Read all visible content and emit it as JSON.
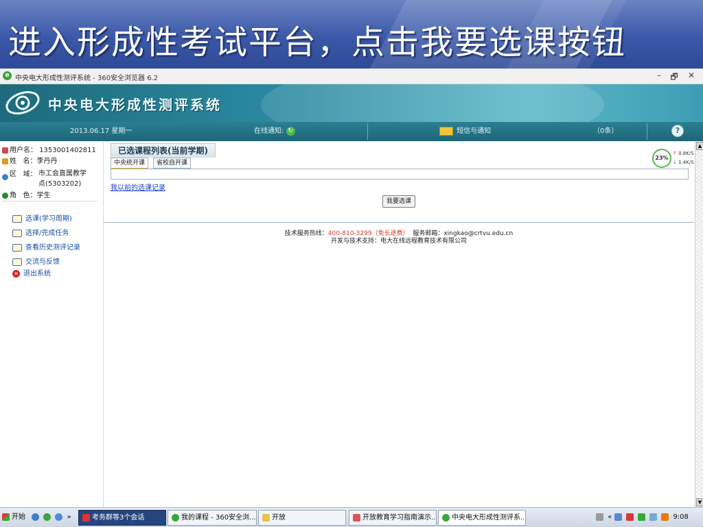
{
  "slide": {
    "title": "进入形成性考试平台，点击我要选课按钮"
  },
  "browser": {
    "title": "中央电大形成性测评系统 - 360安全浏览器 6.2",
    "minimize": "–",
    "restore": "🗗",
    "close": "✕"
  },
  "app": {
    "name": "中央电大形成性测评系统",
    "status": {
      "date": "2013.06.17 星期一",
      "online_notice": "在线通知:",
      "messages": "短信与通知",
      "count": "（0条）",
      "help": "?"
    }
  },
  "user": {
    "username_label": "用户名：",
    "username": "1353001402811",
    "name_label": "姓   名：",
    "name": "李丹丹",
    "region_label": "区   域：",
    "region_line1": "市工会直属教学",
    "region_line2": "点(5303202)",
    "role_label": "角   色：",
    "role": "学生"
  },
  "menu": [
    {
      "label": "选课(学习周期)"
    },
    {
      "label": "选择/完成任务"
    },
    {
      "label": "查看历史测评记录"
    },
    {
      "label": "交流与反馈"
    },
    {
      "label": "退出系统"
    }
  ],
  "main": {
    "section_title": "已选课程列表(当前学期)",
    "tabs": [
      {
        "label": "中央统开课"
      },
      {
        "label": "省校自开课"
      }
    ],
    "history_link": "我以前的选课记录",
    "select_button": "我要选课",
    "footer": {
      "hotline_label": "技术服务热线：",
      "hotline": "400-810-3299（免长途费）",
      "email_label": "服务邮箱：",
      "email": "xingkao@crtvu.edu.cn",
      "support": "开发与技术支持：电大在线远程教育技术有限公司"
    }
  },
  "speed_widget": {
    "percent": "23%",
    "up": "0.8K/S",
    "down": "1.4K/S"
  },
  "taskbar": {
    "start": "开始",
    "chevron": "»",
    "items": [
      {
        "label": "考务群等3个会话"
      },
      {
        "label": "我的课程 - 360安全浏..."
      },
      {
        "label": "开放"
      },
      {
        "label": "开放教育学习指南演示..."
      },
      {
        "label": "中央电大形成性测评系..."
      }
    ],
    "tray_chevron": "«",
    "clock": "9:08"
  },
  "colors": {
    "banner": "#3b58a8",
    "header": "#2b8aa0",
    "statusbar": "#1e6677",
    "link": "#1a3cc8",
    "hotline_red": "#d83a2a"
  }
}
